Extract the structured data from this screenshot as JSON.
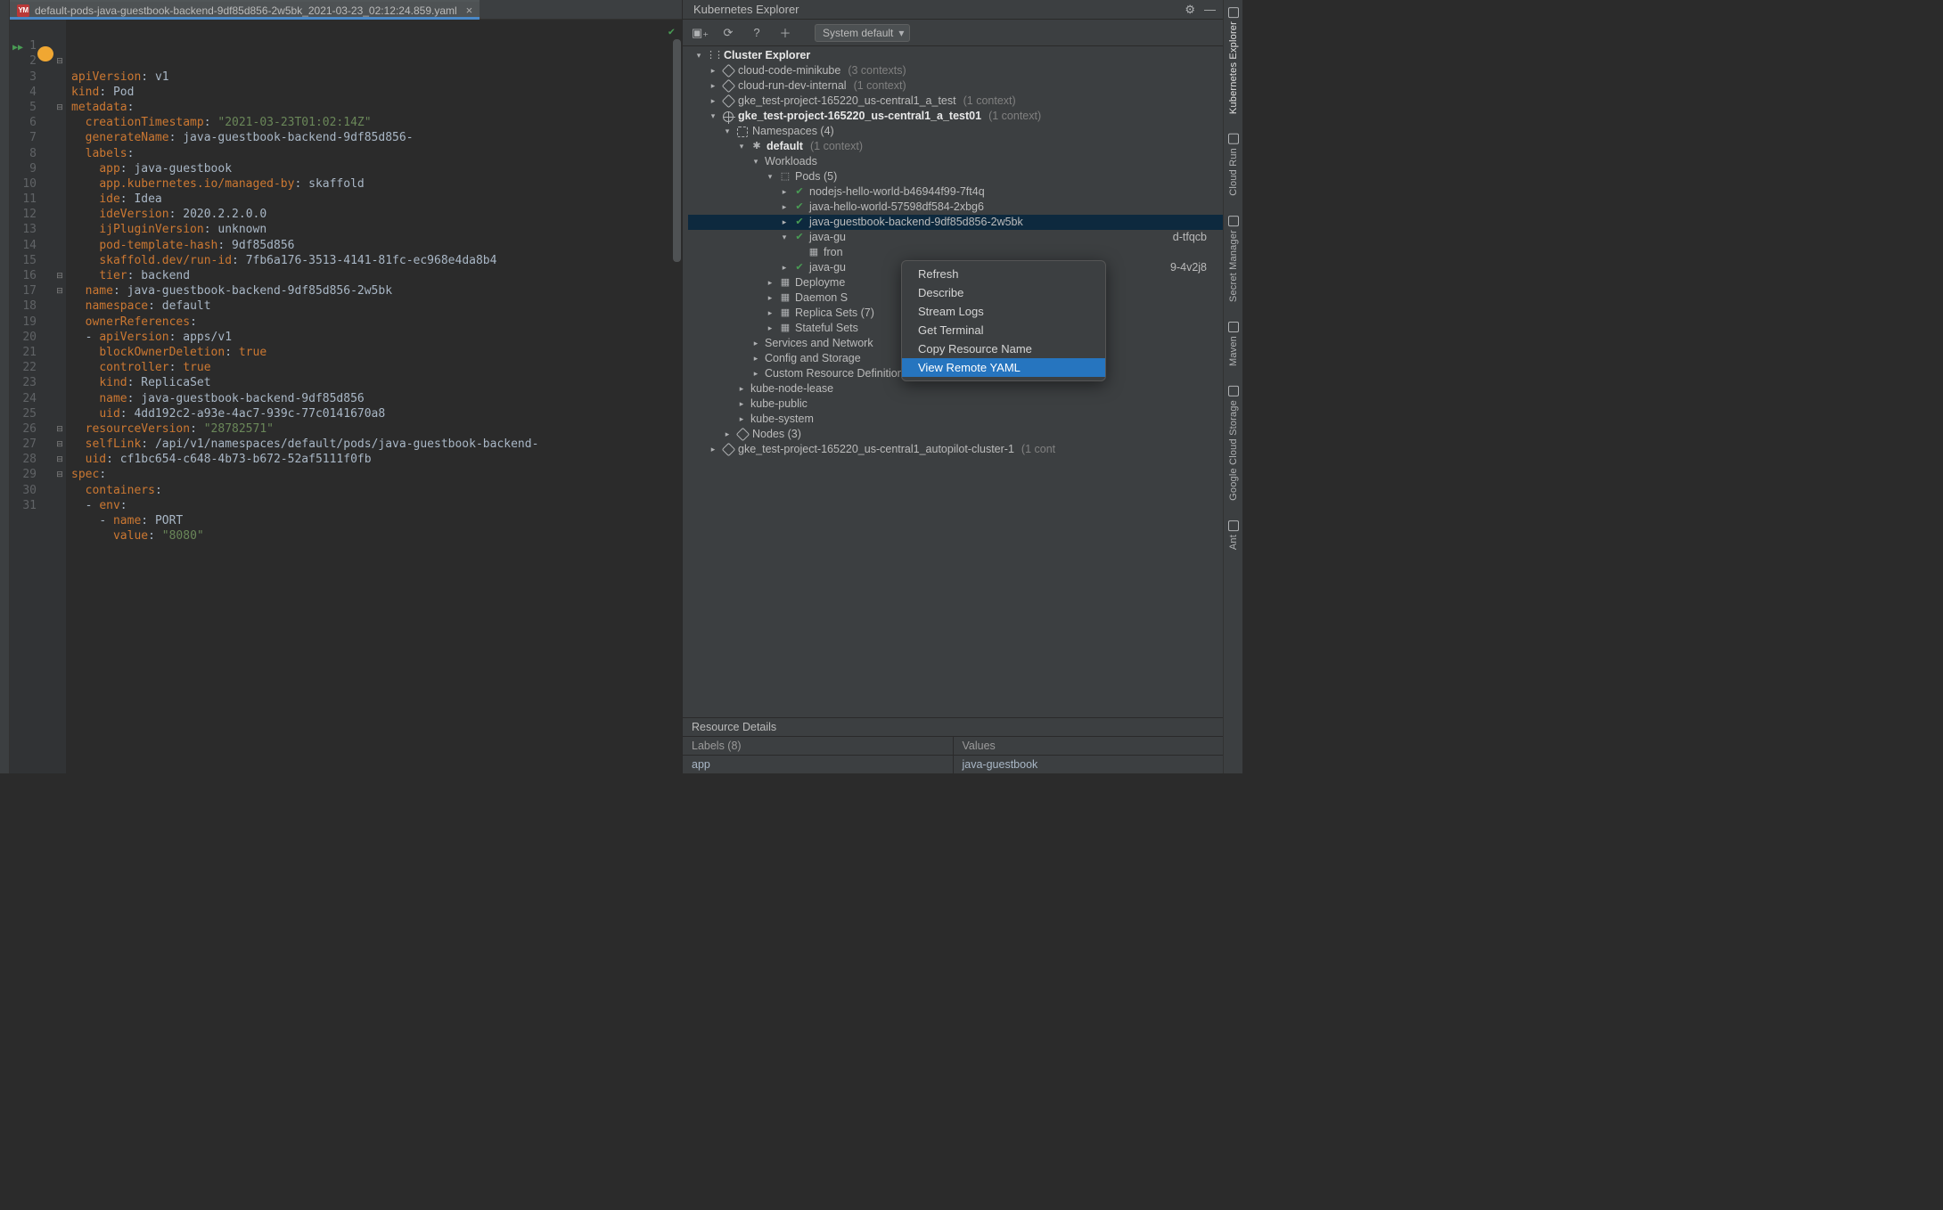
{
  "tab": {
    "title": "default-pods-java-guestbook-backend-9df85d856-2w5bk_2021-03-23_02:12:24.859.yaml",
    "icon_label": "YM"
  },
  "code": [
    [
      [
        "k",
        "apiVersion"
      ],
      [
        null,
        ": "
      ],
      [
        "v",
        "v1"
      ]
    ],
    [
      [
        "k",
        "kind"
      ],
      [
        null,
        ": "
      ],
      [
        "v",
        "Pod"
      ]
    ],
    [
      [
        "k",
        "metadata"
      ],
      [
        null,
        ":"
      ]
    ],
    [
      [
        null,
        "  "
      ],
      [
        "k",
        "creationTimestamp"
      ],
      [
        null,
        ": "
      ],
      [
        "s",
        "\"2021-03-23T01:02:14Z\""
      ]
    ],
    [
      [
        null,
        "  "
      ],
      [
        "k",
        "generateName"
      ],
      [
        null,
        ": "
      ],
      [
        "v",
        "java-guestbook-backend-9df85d856-"
      ]
    ],
    [
      [
        null,
        "  "
      ],
      [
        "k",
        "labels"
      ],
      [
        null,
        ":"
      ]
    ],
    [
      [
        null,
        "    "
      ],
      [
        "k",
        "app"
      ],
      [
        null,
        ": "
      ],
      [
        "v",
        "java-guestbook"
      ]
    ],
    [
      [
        null,
        "    "
      ],
      [
        "k",
        "app.kubernetes.io/managed-by"
      ],
      [
        null,
        ": "
      ],
      [
        "v",
        "skaffold"
      ]
    ],
    [
      [
        null,
        "    "
      ],
      [
        "k",
        "ide"
      ],
      [
        null,
        ": "
      ],
      [
        "v",
        "Idea"
      ]
    ],
    [
      [
        null,
        "    "
      ],
      [
        "k",
        "ideVersion"
      ],
      [
        null,
        ": "
      ],
      [
        "v",
        "2020.2.2.0.0"
      ]
    ],
    [
      [
        null,
        "    "
      ],
      [
        "k",
        "ijPluginVersion"
      ],
      [
        null,
        ": "
      ],
      [
        "v",
        "unknown"
      ]
    ],
    [
      [
        null,
        "    "
      ],
      [
        "k",
        "pod-template-hash"
      ],
      [
        null,
        ": "
      ],
      [
        "v",
        "9df85d856"
      ]
    ],
    [
      [
        null,
        "    "
      ],
      [
        "k",
        "skaffold.dev/run-id"
      ],
      [
        null,
        ": "
      ],
      [
        "v",
        "7fb6a176-3513-4141-81fc-ec968e4da8b4"
      ]
    ],
    [
      [
        null,
        "    "
      ],
      [
        "k",
        "tier"
      ],
      [
        null,
        ": "
      ],
      [
        "v",
        "backend"
      ]
    ],
    [
      [
        null,
        "  "
      ],
      [
        "k",
        "name"
      ],
      [
        null,
        ": "
      ],
      [
        "v",
        "java-guestbook-backend-9df85d856-2w5bk"
      ]
    ],
    [
      [
        null,
        "  "
      ],
      [
        "k",
        "namespace"
      ],
      [
        null,
        ": "
      ],
      [
        "v",
        "default"
      ]
    ],
    [
      [
        null,
        "  "
      ],
      [
        "k",
        "ownerReferences"
      ],
      [
        null,
        ":"
      ]
    ],
    [
      [
        null,
        "  "
      ],
      [
        "d",
        "- "
      ],
      [
        "k",
        "apiVersion"
      ],
      [
        null,
        ": "
      ],
      [
        "v",
        "apps/v1"
      ]
    ],
    [
      [
        null,
        "    "
      ],
      [
        "k",
        "blockOwnerDeletion"
      ],
      [
        null,
        ": "
      ],
      [
        "b",
        "true"
      ]
    ],
    [
      [
        null,
        "    "
      ],
      [
        "k",
        "controller"
      ],
      [
        null,
        ": "
      ],
      [
        "b",
        "true"
      ]
    ],
    [
      [
        null,
        "    "
      ],
      [
        "k",
        "kind"
      ],
      [
        null,
        ": "
      ],
      [
        "v",
        "ReplicaSet"
      ]
    ],
    [
      [
        null,
        "    "
      ],
      [
        "k",
        "name"
      ],
      [
        null,
        ": "
      ],
      [
        "v",
        "java-guestbook-backend-9df85d856"
      ]
    ],
    [
      [
        null,
        "    "
      ],
      [
        "k",
        "uid"
      ],
      [
        null,
        ": "
      ],
      [
        "v",
        "4dd192c2-a93e-4ac7-939c-77c0141670a8"
      ]
    ],
    [
      [
        null,
        "  "
      ],
      [
        "k",
        "resourceVersion"
      ],
      [
        null,
        ": "
      ],
      [
        "s",
        "\"28782571\""
      ]
    ],
    [
      [
        null,
        "  "
      ],
      [
        "k",
        "selfLink"
      ],
      [
        null,
        ": "
      ],
      [
        "v",
        "/api/v1/namespaces/default/pods/java-guestbook-backend-"
      ]
    ],
    [
      [
        null,
        "  "
      ],
      [
        "k",
        "uid"
      ],
      [
        null,
        ": "
      ],
      [
        "v",
        "cf1bc654-c648-4b73-b672-52af5111f0fb"
      ]
    ],
    [
      [
        "k",
        "spec"
      ],
      [
        null,
        ":"
      ]
    ],
    [
      [
        null,
        "  "
      ],
      [
        "k",
        "containers"
      ],
      [
        null,
        ":"
      ]
    ],
    [
      [
        null,
        "  "
      ],
      [
        "d",
        "- "
      ],
      [
        "k",
        "env"
      ],
      [
        null,
        ":"
      ]
    ],
    [
      [
        null,
        "    "
      ],
      [
        "d",
        "- "
      ],
      [
        "k",
        "name"
      ],
      [
        null,
        ": "
      ],
      [
        "v",
        "PORT"
      ]
    ],
    [
      [
        null,
        "      "
      ],
      [
        "k",
        "value"
      ],
      [
        null,
        ": "
      ],
      [
        "s",
        "\"8080\""
      ]
    ]
  ],
  "fold_lines": [
    3,
    6,
    17,
    18,
    27,
    28,
    29,
    30
  ],
  "panel": {
    "title": "Kubernetes Explorer",
    "combo": "System default"
  },
  "tree_rows": [
    {
      "lv": 0,
      "chev": "v",
      "ico": "cluster",
      "txt": "Cluster Explorer",
      "bold": true
    },
    {
      "lv": 1,
      "chev": ">",
      "ico": "hex",
      "txt": "cloud-code-minikube",
      "suffix": "(3 contexts)"
    },
    {
      "lv": 1,
      "chev": ">",
      "ico": "hex",
      "txt": "cloud-run-dev-internal",
      "suffix": "(1 context)"
    },
    {
      "lv": 1,
      "chev": ">",
      "ico": "hex",
      "txt": "gke_test-project-165220_us-central1_a_test",
      "suffix": "(1 context)"
    },
    {
      "lv": 1,
      "chev": "v",
      "ico": "wheel",
      "txt": "gke_test-project-165220_us-central1_a_test01",
      "bold": true,
      "suffix": "(1 context)"
    },
    {
      "lv": 2,
      "chev": "v",
      "ico": "ns",
      "txt": "Namespaces (4)"
    },
    {
      "lv": 3,
      "chev": "v",
      "ico": "star",
      "txt": "default",
      "bold": true,
      "suffix": "(1 context)"
    },
    {
      "lv": 4,
      "chev": "v",
      "txt": "Workloads"
    },
    {
      "lv": 5,
      "chev": "v",
      "ico": "cube",
      "txt": "Pods (5)"
    },
    {
      "lv": 6,
      "chev": ">",
      "ico": "ok",
      "txt": "nodejs-hello-world-b46944f99-7ft4q"
    },
    {
      "lv": 6,
      "chev": ">",
      "ico": "ok",
      "txt": "java-hello-world-57598df584-2xbg6"
    },
    {
      "lv": 6,
      "chev": ">",
      "ico": "ok",
      "txt": "java-guestbook-backend-9df85d856-2w5bk",
      "sel": true
    },
    {
      "lv": 6,
      "chev": "v",
      "ico": "ok",
      "txt": "java-gu",
      "suffix2": "d-tfqcb"
    },
    {
      "lv": 7,
      "chev": "",
      "ico": "svc",
      "txt": "fron"
    },
    {
      "lv": 6,
      "chev": ">",
      "ico": "ok",
      "txt": "java-gu",
      "suffix2": "9-4v2j8"
    },
    {
      "lv": 5,
      "chev": ">",
      "ico": "svc",
      "txt": "Deployme"
    },
    {
      "lv": 5,
      "chev": ">",
      "ico": "svc",
      "txt": "Daemon S"
    },
    {
      "lv": 5,
      "chev": ">",
      "ico": "svc",
      "txt": "Replica Sets (7)"
    },
    {
      "lv": 5,
      "chev": ">",
      "ico": "svc",
      "txt": "Stateful Sets"
    },
    {
      "lv": 4,
      "chev": ">",
      "txt": "Services and Network"
    },
    {
      "lv": 4,
      "chev": ">",
      "txt": "Config and Storage"
    },
    {
      "lv": 4,
      "chev": ">",
      "txt": "Custom Resource Definitions"
    },
    {
      "lv": 3,
      "chev": ">",
      "txt": "kube-node-lease"
    },
    {
      "lv": 3,
      "chev": ">",
      "txt": "kube-public"
    },
    {
      "lv": 3,
      "chev": ">",
      "txt": "kube-system"
    },
    {
      "lv": 2,
      "chev": ">",
      "ico": "hex",
      "txt": "Nodes (3)"
    },
    {
      "lv": 1,
      "chev": ">",
      "ico": "hex",
      "txt": "gke_test-project-165220_us-central1_autopilot-cluster-1",
      "suffix": "(1 cont"
    }
  ],
  "context_menu": [
    "Refresh",
    "Describe",
    "Stream Logs",
    "Get Terminal",
    "Copy Resource Name",
    "View Remote YAML"
  ],
  "context_menu_selected_index": 5,
  "resource_details": {
    "title": "Resource Details",
    "label_header": "Labels (8)",
    "value_header": "Values",
    "label_row": "app",
    "value_row": "java-guestbook"
  },
  "right_tabs": [
    "Kubernetes Explorer",
    "Cloud Run",
    "Secret Manager",
    "Maven",
    "Google Cloud Storage",
    "Ant"
  ]
}
